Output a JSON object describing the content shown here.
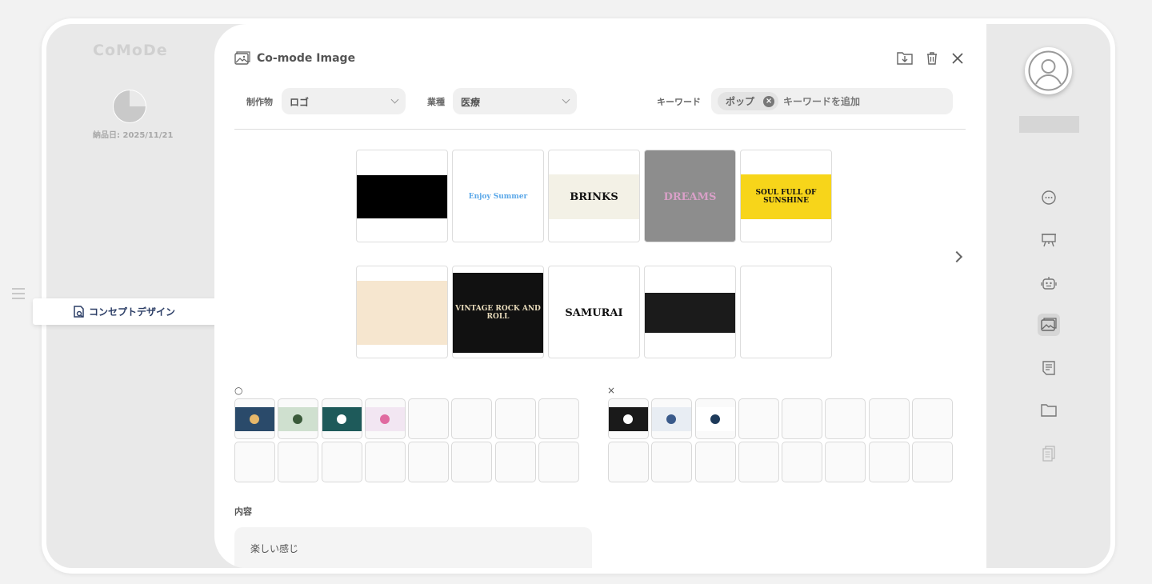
{
  "app": {
    "logo_text": "CoMoDe",
    "delivery_date": "納品日: 2025/11/21",
    "progress_fraction": 0.25
  },
  "sidebar_left": {
    "active_item": "コンセプトデザイン"
  },
  "panel": {
    "title": "Co-mode Image",
    "filters": {
      "product_label": "制作物",
      "product_value": "ロゴ",
      "industry_label": "業種",
      "industry_value": "医療",
      "keyword_label": "キーワード",
      "keyword_chip": "ポップ",
      "keyword_placeholder": "キーワードを追加"
    },
    "gallery": [
      {
        "name": "neon-stickers",
        "bg": "#000000",
        "text": "",
        "fg": "#2ee6a8"
      },
      {
        "name": "enjoy-summer",
        "bg": "#ffffff",
        "text": "Enjoy Summer",
        "fg": "#5aa7e8"
      },
      {
        "name": "brinks",
        "bg": "#f3f1e6",
        "text": "BRINKS",
        "fg": "#111111"
      },
      {
        "name": "dreams",
        "bg": "#8d8d8d",
        "text": "DREAMS",
        "fg": "#d9a0c8"
      },
      {
        "name": "soul-full-of-sunshine",
        "bg": "#f7d51a",
        "text": "SOUL FULL OF SUNSHINE",
        "fg": "#111111"
      },
      {
        "name": "skull-mascot",
        "bg": "#f6e6cf",
        "text": "",
        "fg": "#333333"
      },
      {
        "name": "vintage-rock-and-roll",
        "bg": "#111111",
        "text": "VINTAGE ROCK AND ROLL",
        "fg": "#e9dcbc"
      },
      {
        "name": "samurai",
        "bg": "#ffffff",
        "text": "SAMURAI",
        "fg": "#111111"
      },
      {
        "name": "badges",
        "bg": "#1b1b1b",
        "text": "",
        "fg": "#c94b3a"
      },
      {
        "name": "neon-crocodile",
        "bg": "#ffffff",
        "text": "",
        "fg": "#3bd46a"
      }
    ],
    "liked": {
      "label": "○",
      "items": [
        {
          "bg": "#2a4a6a",
          "accent": "#e7b86a"
        },
        {
          "bg": "#cfe0cf",
          "accent": "#3a5a3a"
        },
        {
          "bg": "#1e5a5a",
          "accent": "#ffffff"
        },
        {
          "bg": "#f2e6f2",
          "accent": "#e06aa0"
        }
      ],
      "total_slots": 16
    },
    "disliked": {
      "label": "×",
      "items": [
        {
          "bg": "#1a1a1a",
          "accent": "#ffffff"
        },
        {
          "bg": "#e8edf3",
          "accent": "#3a5a8a"
        },
        {
          "bg": "#ffffff",
          "accent": "#1d3a5a"
        }
      ],
      "total_slots": 16
    },
    "content_label": "内容",
    "content_text": "楽しい感じ"
  },
  "colors": {
    "accent_navy": "#2c3e66",
    "rail_bg": "#e9e9e9"
  }
}
